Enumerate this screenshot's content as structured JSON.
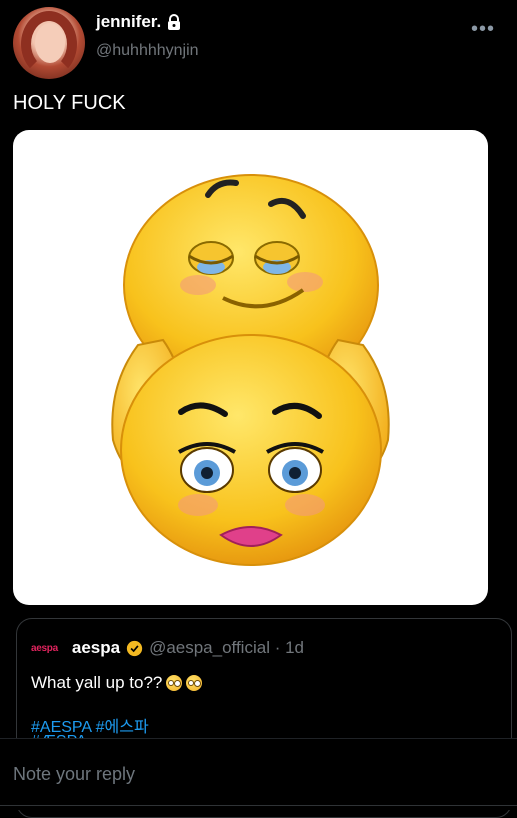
{
  "post": {
    "display_name": "jennifer.",
    "handle": "@huhhhhynjin",
    "text": "HOLY FUCK",
    "more_icon": "more-horizontal-icon",
    "lock_icon": "lock-icon"
  },
  "quote": {
    "logo": "aespa",
    "name": "aespa",
    "handle_time": "@aespa_official · 1d",
    "text": "What yall up to??",
    "tags_line1": "#AESPA #에스파",
    "tags_line2": "#ÆSPA"
  },
  "reply": {
    "placeholder": "Note your reply"
  },
  "colors": {
    "background": "#000000",
    "link": "#1d9bf0",
    "verified": "#f3b922",
    "logo": "#e0245e"
  }
}
